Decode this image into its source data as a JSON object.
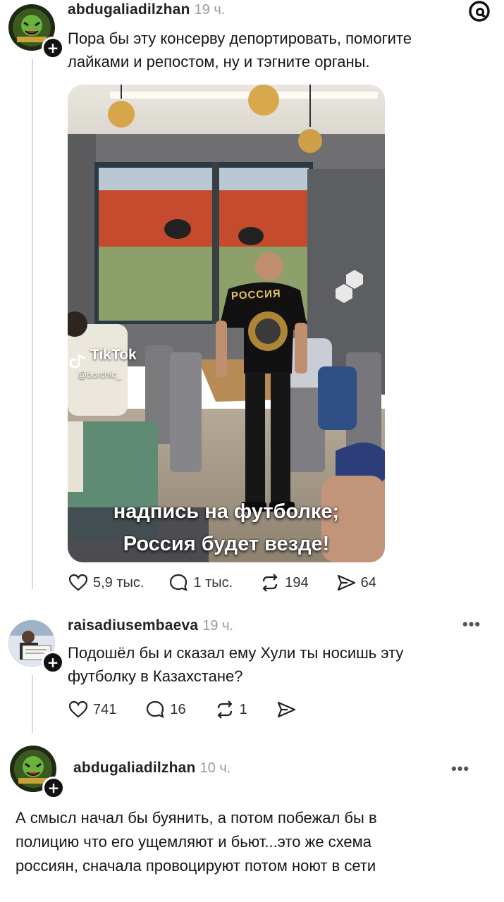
{
  "app": {
    "logo_icon": "threads-logo-icon"
  },
  "post": {
    "username": "abdugaliadilzhan",
    "time": "19 ч.",
    "text_line1": "Пора бы эту консерву депортировать, помогите",
    "text_line2": "лайками и репостом, ну и тэгните органы.",
    "media": {
      "watermark_app": "TikTok",
      "watermark_user": "@borchic_",
      "shirt_text": "РОССИЯ",
      "caption_line1": "надпись на футболке;",
      "caption_line2": "Россия будет везде!"
    },
    "stats": {
      "likes": "5,9 тыс.",
      "comments": "1 тыс.",
      "reposts": "194",
      "shares": "64"
    }
  },
  "reply1": {
    "username": "raisadiusembaeva",
    "time": "19 ч.",
    "more": "•••",
    "text_line1": "Подошёл бы и сказал ему Хули ты носишь эту",
    "text_line2": "футболку в Казахстане?",
    "stats": {
      "likes": "741",
      "comments": "16",
      "reposts": "1"
    }
  },
  "reply2": {
    "username": "abdugaliadilzhan",
    "time": "10 ч.",
    "more": "•••",
    "text_line1": "А смысл начал бы буянить, а потом побежал бы в",
    "text_line2": "полицию что его ущемляют и бьют...это же схема",
    "text_line3": "россиян, сначала провоцируют потом ноют в сети"
  },
  "colors": {
    "text": "#161616",
    "muted": "#9a9a9a",
    "line": "#d9d9d9"
  }
}
